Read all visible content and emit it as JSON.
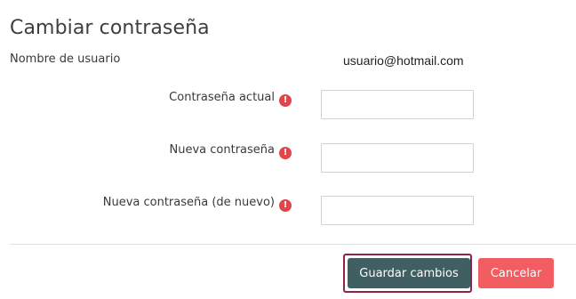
{
  "page": {
    "title": "Cambiar contraseña"
  },
  "username": {
    "label": "Nombre de usuario",
    "value": "usuario@hotmail.com"
  },
  "fields": [
    {
      "label": "Contraseña actual",
      "value": "",
      "required_icon": "exclamation-circle-icon"
    },
    {
      "label": "Nueva contraseña",
      "value": "",
      "required_icon": "exclamation-circle-icon"
    },
    {
      "label": "Nueva contraseña (de nuevo)",
      "value": "",
      "required_icon": "exclamation-circle-icon"
    }
  ],
  "required_icon_glyph": "!",
  "actions": {
    "save_label": "Guardar cambios",
    "cancel_label": "Cancelar"
  },
  "colors": {
    "save_button": "#3f5f63",
    "cancel_button": "#f15d61",
    "required_icon": "#e0464a",
    "focus_ring": "#8e2448"
  }
}
